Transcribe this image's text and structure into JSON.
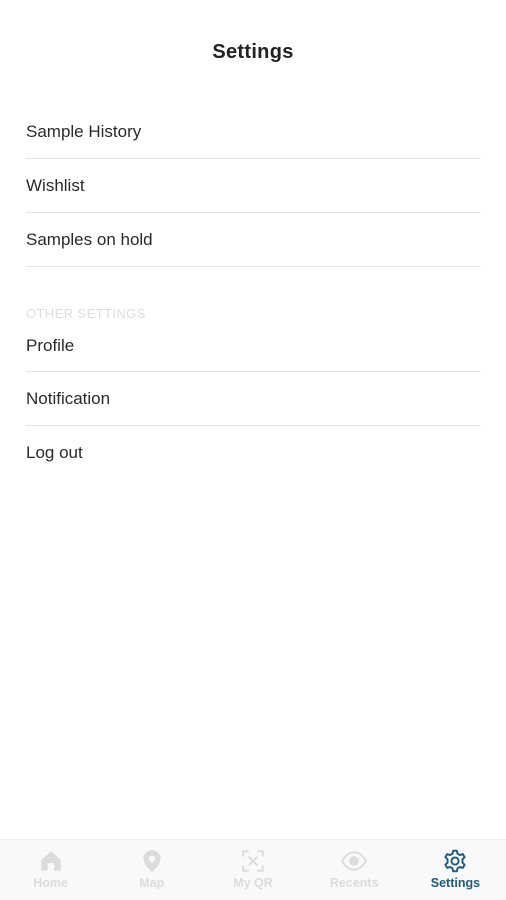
{
  "header": {
    "title": "Settings"
  },
  "menu": {
    "primary": [
      {
        "label": "Sample History"
      },
      {
        "label": "Wishlist"
      },
      {
        "label": "Samples on hold"
      }
    ],
    "other_section_label": "OTHER SETTINGS",
    "other": [
      {
        "label": "Profile"
      },
      {
        "label": "Notification"
      },
      {
        "label": "Log out"
      }
    ]
  },
  "tabbar": {
    "active": "Settings",
    "active_color": "#1b5e7a",
    "inactive_color": "#dcdcdc",
    "tabs": [
      {
        "label": "Home",
        "icon": "home-icon"
      },
      {
        "label": "Map",
        "icon": "map-pin-icon"
      },
      {
        "label": "My QR",
        "icon": "qr-scan-icon"
      },
      {
        "label": "Recents",
        "icon": "eye-icon"
      },
      {
        "label": "Settings",
        "icon": "gear-icon"
      }
    ]
  }
}
